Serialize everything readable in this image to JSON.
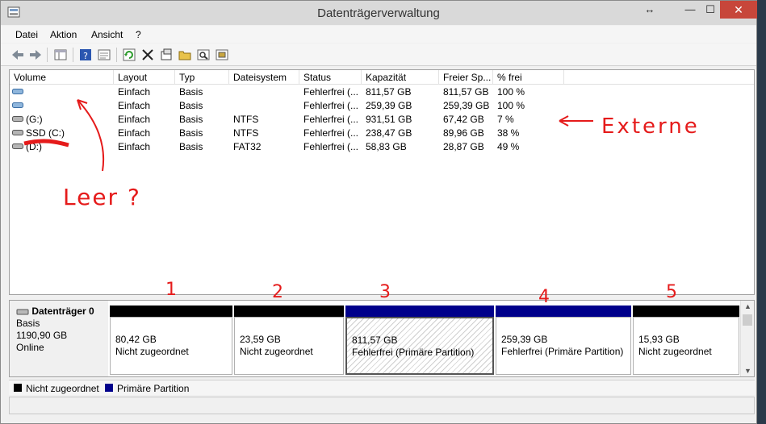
{
  "window": {
    "title": "Datenträgerverwaltung"
  },
  "menu": [
    "Datei",
    "Aktion",
    "Ansicht",
    "?"
  ],
  "toolbar": [
    "back-icon",
    "forward-icon",
    "console-tree-icon",
    "help-icon",
    "properties-view-icon",
    "refresh-icon",
    "delete-icon",
    "properties-icon",
    "open-icon",
    "search-icon",
    "settings-icon"
  ],
  "volume_table": {
    "columns": [
      "Volume",
      "Layout",
      "Typ",
      "Dateisystem",
      "Status",
      "Kapazität",
      "Freier Sp...",
      "% frei"
    ],
    "rows": [
      {
        "volume": "",
        "layout": "Einfach",
        "typ": "Basis",
        "fs": "",
        "status": "Fehlerfrei (...",
        "kap": "811,57 GB",
        "frei": "811,57 GB",
        "pct": "100 %"
      },
      {
        "volume": "",
        "layout": "Einfach",
        "typ": "Basis",
        "fs": "",
        "status": "Fehlerfrei (...",
        "kap": "259,39 GB",
        "frei": "259,39 GB",
        "pct": "100 %"
      },
      {
        "volume": "(G:)",
        "layout": "Einfach",
        "typ": "Basis",
        "fs": "NTFS",
        "status": "Fehlerfrei (...",
        "kap": "931,51 GB",
        "frei": "67,42 GB",
        "pct": "7 %"
      },
      {
        "volume": "SSD (C:)",
        "layout": "Einfach",
        "typ": "Basis",
        "fs": "NTFS",
        "status": "Fehlerfrei (...",
        "kap": "238,47 GB",
        "frei": "89,96 GB",
        "pct": "38 %"
      },
      {
        "volume": "(D:)",
        "layout": "Einfach",
        "typ": "Basis",
        "fs": "FAT32",
        "status": "Fehlerfrei (...",
        "kap": "58,83 GB",
        "frei": "28,87 GB",
        "pct": "49 %"
      }
    ]
  },
  "disk": {
    "name": "Datenträger 0",
    "type": "Basis",
    "size": "1190,90 GB",
    "state": "Online"
  },
  "partitions": [
    {
      "size": "80,42 GB",
      "status": "Nicht zugeordnet",
      "color": "#000000"
    },
    {
      "size": "23,59 GB",
      "status": "Nicht zugeordnet",
      "color": "#000000"
    },
    {
      "size": "811,57 GB",
      "status": "Fehlerfrei (Primäre Partition)",
      "color": "#00008b"
    },
    {
      "size": "259,39 GB",
      "status": "Fehlerfrei (Primäre Partition)",
      "color": "#00008b"
    },
    {
      "size": "15,93 GB",
      "status": "Nicht zugeordnet",
      "color": "#000000"
    }
  ],
  "legend": [
    {
      "label": "Nicht zugeordnet",
      "color": "#000000"
    },
    {
      "label": "Primäre Partition",
      "color": "#00008b"
    }
  ],
  "annotations": {
    "leer": "Leer ?",
    "externe": "Externe",
    "numbers": [
      "1",
      "2",
      "3",
      "4",
      "5"
    ]
  },
  "window_controls": {
    "move": "↔",
    "minimize": "—",
    "maximize": "☐",
    "close": "✕"
  }
}
